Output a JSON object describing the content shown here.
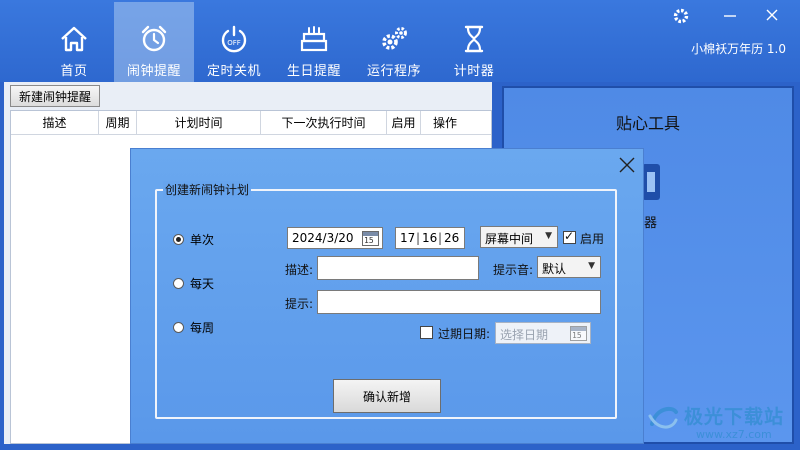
{
  "header": {
    "nav": [
      {
        "label": "首页",
        "icon": "home-icon"
      },
      {
        "label": "闹钟提醒",
        "icon": "alarm-clock-icon",
        "active": true
      },
      {
        "label": "定时关机",
        "icon": "power-off-icon"
      },
      {
        "label": "生日提醒",
        "icon": "birthday-cake-icon"
      },
      {
        "label": "运行程序",
        "icon": "gears-icon"
      },
      {
        "label": "计时器",
        "icon": "hourglass-icon"
      }
    ],
    "app_version": "小棉袄万年历 1.0",
    "settings_icon": "gear-icon",
    "minimize_icon": "minimize-icon",
    "close_icon": "close-icon"
  },
  "alarm_panel": {
    "new_button": "新建闹钟提醒",
    "columns": [
      "描述",
      "周期",
      "计划时间",
      "下一次执行时间",
      "启用",
      "操作"
    ]
  },
  "tools_panel": {
    "title": "贴心工具",
    "partial_item_label": "器"
  },
  "watermark": {
    "title": "极光下载站",
    "url": "www.xz7.com"
  },
  "dialog": {
    "legend": "创建新闹钟计划",
    "frequency_options": [
      {
        "label": "单次",
        "selected": true
      },
      {
        "label": "每天",
        "selected": false
      },
      {
        "label": "每周",
        "selected": false
      }
    ],
    "date_value": "2024/3/20",
    "calendar_day": "15",
    "time_hour": "17",
    "time_minute": "16",
    "time_second": "26",
    "position_select": "屏幕中间",
    "enabled_label": "启用",
    "enabled_checked": true,
    "description_label": "描述:",
    "description_value": "",
    "sound_label": "提示音:",
    "sound_select": "默认",
    "prompt_label": "提示:",
    "prompt_value": "",
    "expire_label": "过期日期:",
    "expire_checked": false,
    "expire_placeholder": "选择日期",
    "confirm_button": "确认新增"
  },
  "colors": {
    "header_bg": "#3a78de",
    "dialog_bg": "#6aa8ef",
    "tools_bg": "#5b96ee",
    "watermark": "#3c8fd8"
  }
}
